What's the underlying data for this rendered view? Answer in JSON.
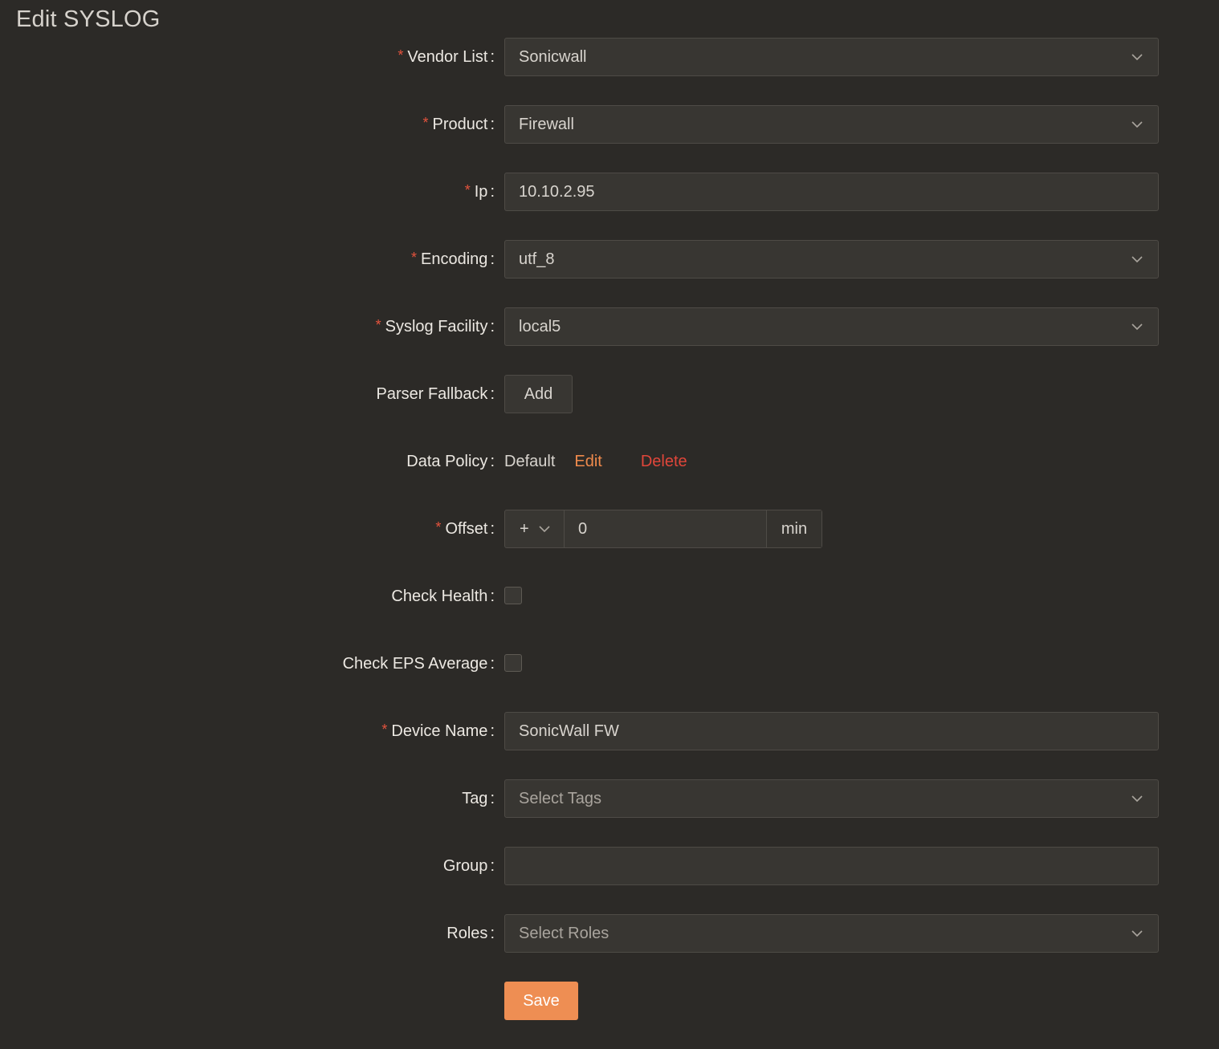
{
  "page": {
    "title": "Edit SYSLOG"
  },
  "form": {
    "vendor": {
      "label": "Vendor List",
      "value": "Sonicwall"
    },
    "product": {
      "label": "Product",
      "value": "Firewall"
    },
    "ip": {
      "label": "Ip",
      "value": "10.10.2.95"
    },
    "encoding": {
      "label": "Encoding",
      "value": "utf_8"
    },
    "facility": {
      "label": "Syslog Facility",
      "value": "local5"
    },
    "parser_fallback": {
      "label": "Parser Fallback",
      "button": "Add"
    },
    "data_policy": {
      "label": "Data Policy",
      "value": "Default",
      "edit": "Edit",
      "delete": "Delete"
    },
    "offset": {
      "label": "Offset",
      "sign": "+",
      "value": "0",
      "unit": "min"
    },
    "check_health": {
      "label": "Check Health",
      "checked": false
    },
    "check_eps": {
      "label": "Check EPS Average",
      "checked": false
    },
    "device_name": {
      "label": "Device Name",
      "value": "SonicWall FW"
    },
    "tag": {
      "label": "Tag",
      "placeholder": "Select Tags"
    },
    "group": {
      "label": "Group",
      "value": ""
    },
    "roles": {
      "label": "Roles",
      "placeholder": "Select Roles"
    },
    "save": "Save"
  },
  "icons": {
    "dropdown": "chevron-down-icon"
  },
  "colors": {
    "background": "#2c2a27",
    "required": "#e5533d",
    "accent": "#ee8e53",
    "danger": "#e0463a"
  }
}
